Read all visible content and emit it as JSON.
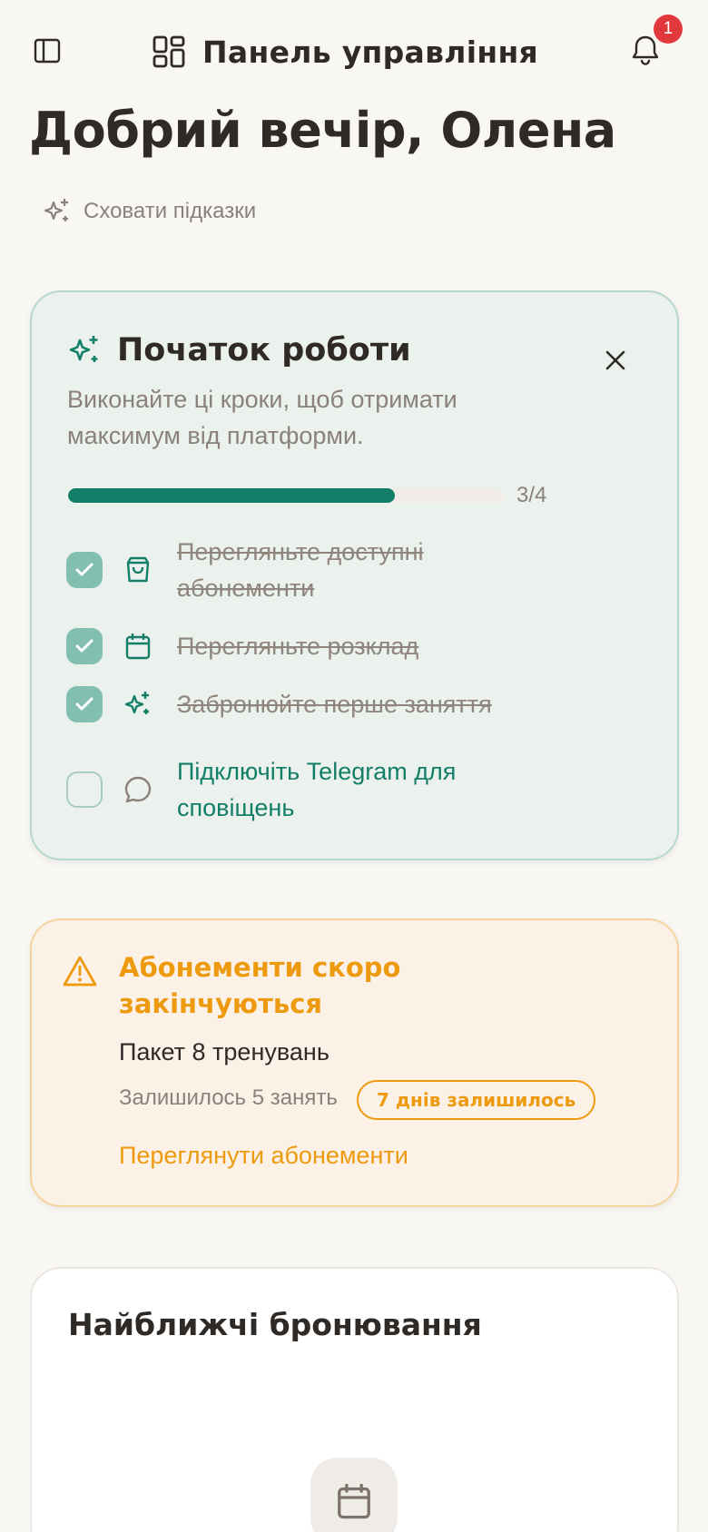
{
  "header": {
    "title": "Панель управління",
    "notifications_count": "1",
    "icons": [
      "sidebar-toggle-icon",
      "dashboard-grid-icon",
      "bell-icon"
    ]
  },
  "greeting": "Добрий вечір, Олена",
  "hints": {
    "hide_label": "Сховати підказки",
    "icon": "sparkles-icon"
  },
  "getting_started": {
    "title": "Початок роботи",
    "description": "Виконайте ці кроки, щоб отримати максимум від платформи.",
    "progress_text": "3/4",
    "progress_fraction": 0.75,
    "steps": [
      {
        "label": "Перегляньте доступні абонементи",
        "done": true,
        "icon": "shopping-bag-icon"
      },
      {
        "label": "Перегляньте розклад",
        "done": true,
        "icon": "calendar-icon"
      },
      {
        "label": "Забронюйте перше заняття",
        "done": true,
        "icon": "sparkles-icon"
      },
      {
        "label": "Підключіть Telegram для сповіщень",
        "done": false,
        "icon": "chat-bubble-icon"
      }
    ]
  },
  "expiring": {
    "title": "Абонементи скоро закінчуються",
    "package": "Пакет 8 тренувань",
    "sessions_left": "Залишилось 5 занять",
    "days_badge": "7 днів залишилось",
    "link": "Переглянути абонементи",
    "accent": "#ed9a0f"
  },
  "bookings": {
    "title": "Найближчі бронювання",
    "icon": "calendar-icon"
  },
  "colors": {
    "brand_green": "#147f68",
    "background": "#f9f7f4",
    "badge_red": "#e0383b"
  }
}
